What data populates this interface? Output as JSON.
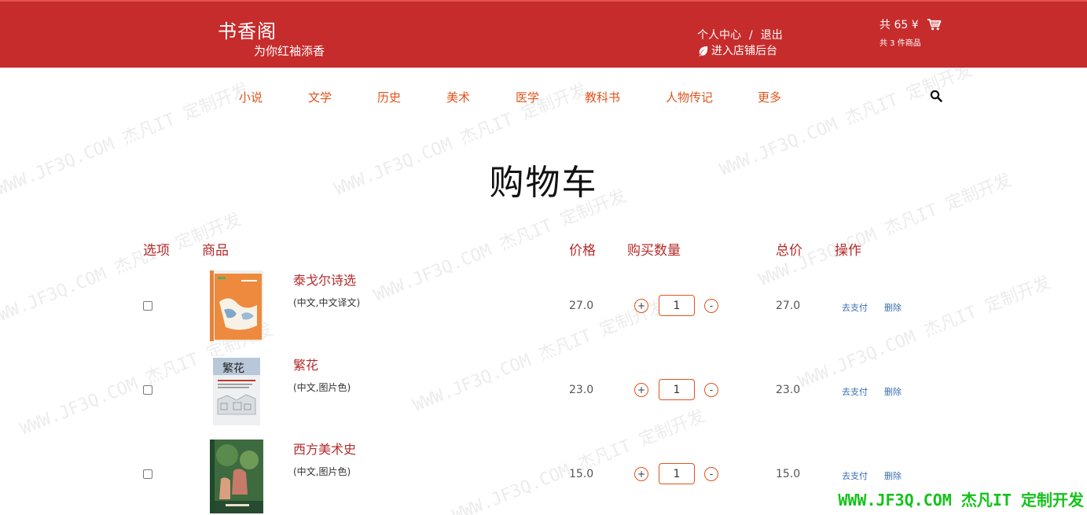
{
  "header": {
    "brand_title": "书香阁",
    "brand_slogan": "为你红袖添香",
    "user_center": "个人中心",
    "separator": "/",
    "logout": "退出",
    "store_admin": "进入店铺后台",
    "cart_total": "共 65 ¥",
    "cart_count": "共 3 件商品"
  },
  "nav": {
    "items": [
      "小说",
      "文学",
      "历史",
      "美术",
      "医学",
      "教科书",
      "人物传记",
      "更多"
    ]
  },
  "page_title": "购物车",
  "table": {
    "headers": {
      "select": "选项",
      "product": "商品",
      "price": "价格",
      "quantity": "购买数量",
      "total": "总价",
      "action": "操作"
    },
    "rows": [
      {
        "name": "泰戈尔诗选",
        "spec": "(中文,中文译文)",
        "price": "27.0",
        "qty": "1",
        "total": "27.0",
        "pay": "去支付",
        "delete": "删除"
      },
      {
        "name": "繁花",
        "spec": "(中文,图片色)",
        "price": "23.0",
        "qty": "1",
        "total": "23.0",
        "pay": "去支付",
        "delete": "删除"
      },
      {
        "name": "西方美术史",
        "spec": "(中文,图片色)",
        "price": "15.0",
        "qty": "1",
        "total": "15.0",
        "pay": "去支付",
        "delete": "删除"
      }
    ],
    "plus_label": "+",
    "minus_label": "-"
  },
  "watermark": {
    "text": "WWW.JF3Q.COM 杰凡IT  定制开发",
    "bottom_text": "WWW.JF3Q.COM 杰凡IT  定制开发"
  },
  "colors": {
    "header_bg": "#c62c2c",
    "accent_orange": "#e0541c",
    "heading_red": "#b52b2b",
    "link_blue": "#3a6fb0",
    "watermark_green": "#14c21a"
  }
}
